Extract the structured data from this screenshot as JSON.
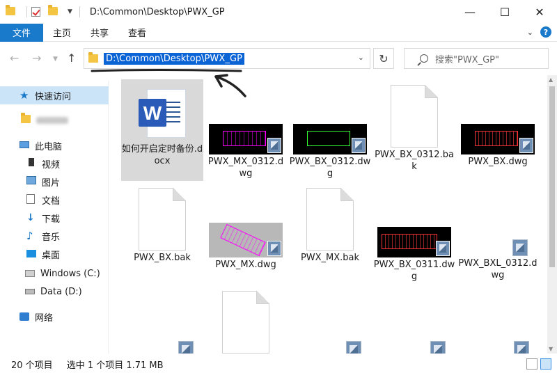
{
  "window": {
    "title_path": "D:\\Common\\Desktop\\PWX_GP",
    "minimize": "—",
    "maximize": "☐",
    "close": "✕"
  },
  "ribbon": {
    "tabs": [
      "文件",
      "主页",
      "共享",
      "查看"
    ]
  },
  "address": {
    "path": "D:\\Common\\Desktop\\PWX_GP",
    "search_placeholder": "搜索\"PWX_GP\""
  },
  "sidebar": {
    "items": [
      {
        "label": "快速访问",
        "icon": "star-icon"
      },
      {
        "label": "",
        "icon": "user-folder-icon"
      },
      {
        "label": "此电脑",
        "icon": "computer-icon"
      },
      {
        "label": "视频",
        "icon": "video-icon"
      },
      {
        "label": "图片",
        "icon": "picture-icon"
      },
      {
        "label": "文档",
        "icon": "document-icon"
      },
      {
        "label": "下载",
        "icon": "download-icon"
      },
      {
        "label": "音乐",
        "icon": "music-icon"
      },
      {
        "label": "桌面",
        "icon": "desktop-icon"
      },
      {
        "label": "Windows (C:)",
        "icon": "windows-drive-icon"
      },
      {
        "label": "Data (D:)",
        "icon": "drive-icon"
      },
      {
        "label": "网络",
        "icon": "network-icon"
      }
    ]
  },
  "files": [
    {
      "name": "如何开启定时备份.docx",
      "type": "word"
    },
    {
      "name": "PWX_MX_0312.dwg",
      "type": "dwg"
    },
    {
      "name": "PWX_BX_0312.dwg",
      "type": "dwg"
    },
    {
      "name": "PWX_BX_0312.bak",
      "type": "bak"
    },
    {
      "name": "PWX_BX.dwg",
      "type": "dwg"
    },
    {
      "name": "PWX_BX.bak",
      "type": "bak"
    },
    {
      "name": "PWX_MX.dwg",
      "type": "dwg"
    },
    {
      "name": "PWX_MX.bak",
      "type": "bak"
    },
    {
      "name": "PWX_BX_0311.dwg",
      "type": "dwg"
    },
    {
      "name": "PWX_BXL_0312.dwg",
      "type": "dwg"
    }
  ],
  "status": {
    "count": "20 个项目",
    "selection": "选中 1 个项目  1.71 MB"
  },
  "colors": {
    "accent": "#1979ca",
    "selection_bg": "#d9d9d9",
    "address_highlight": "#0a64d6"
  }
}
